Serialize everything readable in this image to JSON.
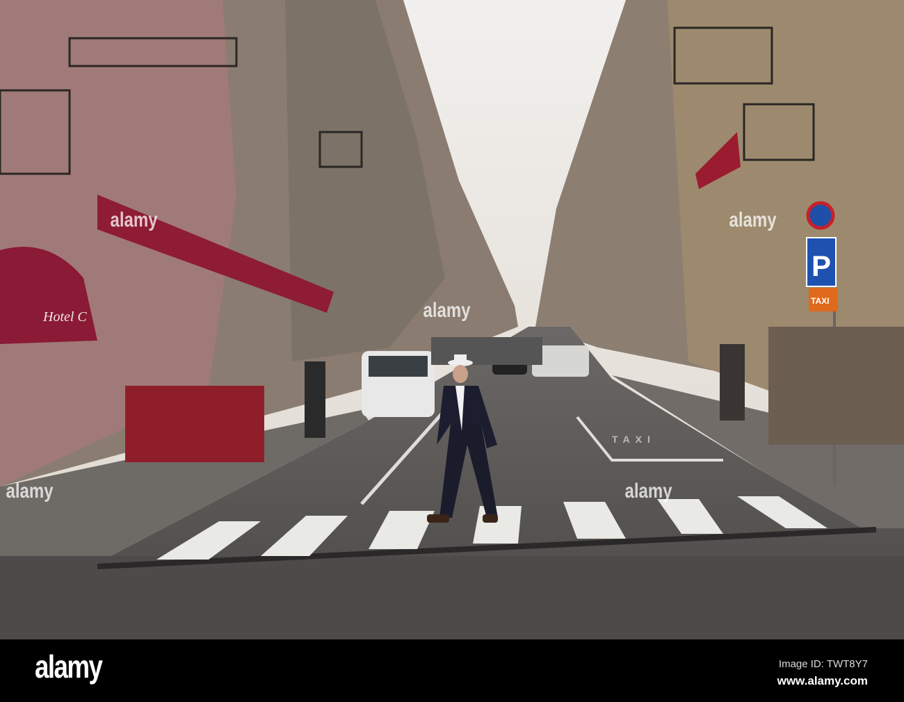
{
  "photo": {
    "signs": {
      "hotel_awning": "Hotel C",
      "parking": "P",
      "taxi_sign": "TAXI",
      "road_marking": "TAXI"
    }
  },
  "watermark": {
    "text": "alamy"
  },
  "footer": {
    "logo": "alamy",
    "image_id": "Image ID: TWT8Y7",
    "website": "www.alamy.com"
  }
}
